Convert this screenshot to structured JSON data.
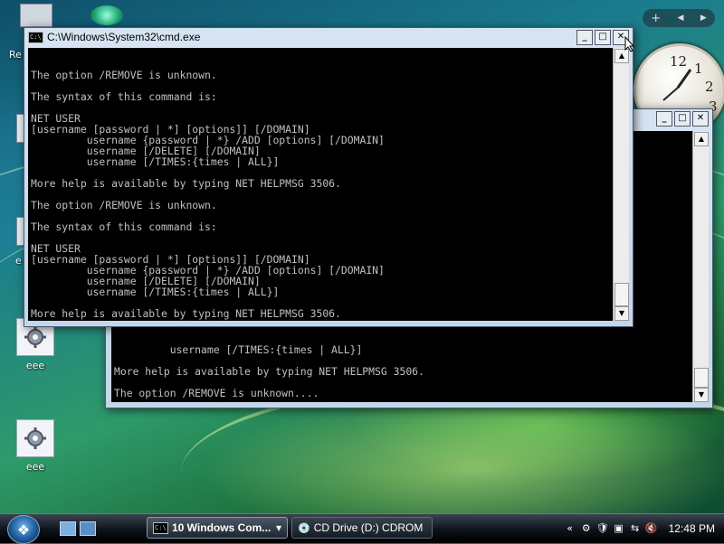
{
  "desktop": {
    "icons": [
      {
        "label": "eee"
      },
      {
        "label": "eee"
      }
    ],
    "partial_labels": {
      "left_top": "Re",
      "left_mid": "e"
    }
  },
  "gadget_bar": {
    "add": "+",
    "prev": "◀",
    "next": "▶"
  },
  "clock": {
    "n12": "12",
    "n1": "1",
    "n2": "2",
    "n3": "3"
  },
  "front_window": {
    "title": "C:\\Windows\\System32\\cmd.exe",
    "icon_text": "C:\\",
    "buttons": {
      "min": "_",
      "max": "□",
      "close": "✕"
    },
    "lines": [
      "The option /REMOVE is unknown.",
      "",
      "The syntax of this command is:",
      "",
      "NET USER",
      "[username [password | *] [options]] [/DOMAIN]",
      "         username {password | *} /ADD [options] [/DOMAIN]",
      "         username [/DELETE] [/DOMAIN]",
      "         username [/TIMES:{times | ALL}]",
      "",
      "More help is available by typing NET HELPMSG 3506.",
      "",
      "The option /REMOVE is unknown.",
      "",
      "The syntax of this command is:",
      "",
      "NET USER",
      "[username [password | *] [options]] [/DOMAIN]",
      "         username {password | *} /ADD [options] [/DOMAIN]",
      "         username [/DELETE] [/DOMAIN]",
      "         username [/TIMES:{times | ALL}]",
      "",
      "More help is available by typing NET HELPMSG 3506.",
      ""
    ],
    "scroll_up": "▲",
    "scroll_down": "▼"
  },
  "back_window": {
    "buttons": {
      "min": "_",
      "max": "□",
      "close": "✕"
    },
    "lines": [
      "         username [/TIMES:{times | ALL}]",
      "",
      "More help is available by typing NET HELPMSG 3506.",
      "",
      "The option /REMOVE is unknown...."
    ],
    "scroll_up": "▲",
    "scroll_down": "▼"
  },
  "taskbar": {
    "start_glyph": "❖",
    "buttons": [
      {
        "icon": "C:\\",
        "label": "10 Windows Com...",
        "dropdown": "▾"
      },
      {
        "icon": "💿",
        "label": "CD Drive (D:) CDROM"
      }
    ],
    "tray_icons": [
      "⚙",
      "🛡",
      "▣",
      "⇆",
      "🔇"
    ],
    "expand": "«",
    "time": "12:48 PM"
  }
}
